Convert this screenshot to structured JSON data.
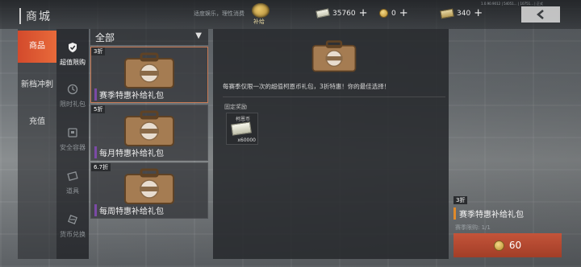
{
  "header": {
    "title": "商城",
    "notice": "适度娱乐，理性消费",
    "supply_label": "补给",
    "currencies": [
      {
        "name": "bills",
        "icon": "cash-icon",
        "value": "35760"
      },
      {
        "name": "coins",
        "icon": "coin-icon",
        "value": "0"
      },
      {
        "name": "tokens",
        "icon": "token-stack-icon",
        "value": "340"
      }
    ],
    "build": "1.0.90.9012 | 54051... | 10751... | 正式"
  },
  "categories": [
    {
      "label": "商品",
      "active": true
    },
    {
      "label": "新档冲刺",
      "active": false
    },
    {
      "label": "充值",
      "active": false
    }
  ],
  "subcategories": [
    {
      "label": "超值限购",
      "icon": "shield-check-icon",
      "active": true
    },
    {
      "label": "限时礼包",
      "icon": "clock-icon",
      "active": false
    },
    {
      "label": "安全容器",
      "icon": "container-icon",
      "active": false
    },
    {
      "label": "道具",
      "icon": "ticket-icon",
      "active": false
    },
    {
      "label": "货币兑换",
      "icon": "exchange-icon",
      "active": false
    }
  ],
  "list": {
    "filter_label": "全部",
    "items": [
      {
        "discount": "3折",
        "name": "赛季特惠补给礼包"
      },
      {
        "discount": "5折",
        "name": "每月特惠补给礼包"
      },
      {
        "discount": "6.7折",
        "name": "每周特惠补给礼包"
      }
    ]
  },
  "detail": {
    "description": "每赛季仅限一次的超值柯恩币礼包，3折特惠！你的最佳选择！",
    "fixed_reward_label": "固定奖励",
    "reward": {
      "title": "柯恩币",
      "qty": "x60000"
    }
  },
  "purchase": {
    "discount": "3折",
    "name": "赛季特惠补给礼包",
    "limit": "赛季限购: 1/1",
    "price": "60"
  },
  "colors": {
    "accent": "#d34a2c",
    "buy": "#b2462f",
    "selected_border": "#c87a55"
  }
}
